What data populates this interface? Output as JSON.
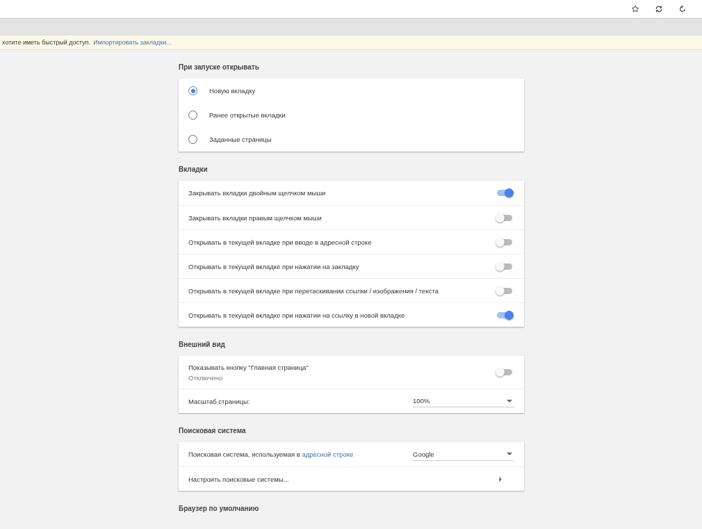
{
  "bookmark_bar": {
    "text": "хотите иметь быстрый доступ.",
    "link": "Импортировать закладки..."
  },
  "sections": [
    {
      "title": "При запуске открывать",
      "items": [
        {
          "kind": "radio",
          "label": "Новую вкладку",
          "selected": true
        },
        {
          "kind": "radio",
          "label": "Ранее открытые вкладки",
          "selected": false
        },
        {
          "kind": "radio",
          "label": "Заданные страницы",
          "selected": false
        }
      ]
    },
    {
      "title": "Вкладки",
      "items": [
        {
          "kind": "toggle",
          "label": "Закрывать вкладки двойным щелчком мыши",
          "on": true
        },
        {
          "kind": "toggle",
          "label": "Закрывать вкладки правым щелчком мыши",
          "on": false
        },
        {
          "kind": "toggle",
          "label": "Открывать в текущей вкладке при вводе в адресной строке",
          "on": false
        },
        {
          "kind": "toggle",
          "label": "Открывать в текущей вкладке при нажатии на закладку",
          "on": false
        },
        {
          "kind": "toggle",
          "label": "Открывать в текущей вкладке при перетаскивании ссылки / изображения / текста",
          "on": false
        },
        {
          "kind": "toggle",
          "label": "Открывать в текущей вкладке при нажатии на ссылку в новой вкладке",
          "on": true
        }
      ]
    },
    {
      "title": "Внешний вид",
      "items": [
        {
          "kind": "toggle",
          "label": "Показывать кнопку \"Главная страница\"",
          "sublabel": "Отключено",
          "on": false
        },
        {
          "kind": "select",
          "label": "Масштаб страницы:",
          "value": "100%"
        }
      ]
    },
    {
      "title": "Поисковая система",
      "items": [
        {
          "kind": "select",
          "label": "Поисковая система, используемая в",
          "link": "адресной строке",
          "value": "Google"
        },
        {
          "kind": "link-row",
          "label": "Настроить поисковые системы..."
        }
      ]
    },
    {
      "title": "Браузер по умолчанию"
    }
  ]
}
